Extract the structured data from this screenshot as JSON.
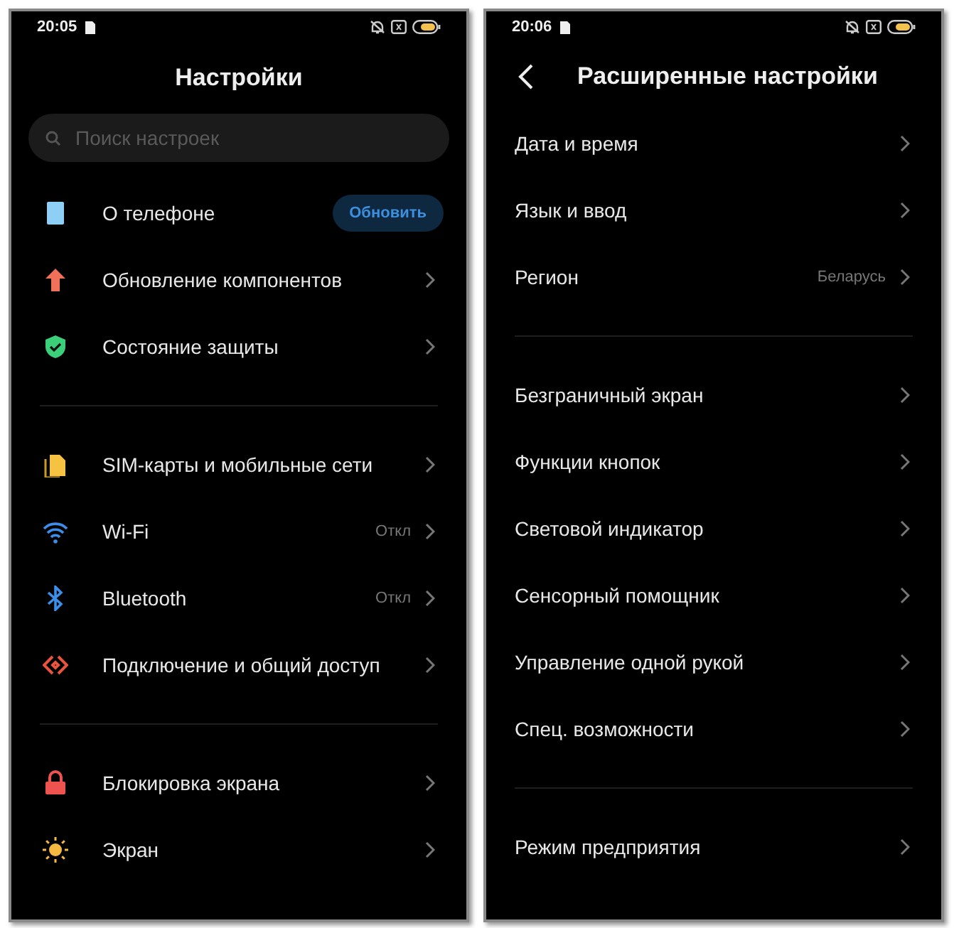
{
  "panels": [
    {
      "status_bar": {
        "time": "20:05"
      },
      "header": {
        "title": "Настройки",
        "back": false
      },
      "search": {
        "placeholder": "Поиск настроек"
      },
      "sections": [
        {
          "items": [
            {
              "kind": "phone",
              "label": "О телефоне",
              "button": "Обновить"
            },
            {
              "kind": "arrow-up",
              "label": "Обновление компонентов"
            },
            {
              "kind": "shield",
              "label": "Состояние защиты"
            }
          ]
        },
        {
          "items": [
            {
              "kind": "sim",
              "label": "SIM-карты и мобильные сети"
            },
            {
              "kind": "wifi",
              "label": "Wi-Fi",
              "value": "Откл"
            },
            {
              "kind": "bluetooth",
              "label": "Bluetooth",
              "value": "Откл"
            },
            {
              "kind": "share",
              "label": "Подключение и общий доступ"
            }
          ]
        },
        {
          "items": [
            {
              "kind": "lock",
              "label": "Блокировка экрана"
            },
            {
              "kind": "sun",
              "label": "Экран"
            }
          ]
        }
      ]
    },
    {
      "status_bar": {
        "time": "20:06"
      },
      "header": {
        "title": "Расширенные настройки",
        "back": true
      },
      "sections": [
        {
          "items": [
            {
              "kind": "plain",
              "label": "Дата и время"
            },
            {
              "kind": "plain",
              "label": "Язык и ввод"
            },
            {
              "kind": "plain",
              "label": "Регион",
              "value": "Беларусь"
            }
          ]
        },
        {
          "items": [
            {
              "kind": "plain",
              "label": "Безграничный экран"
            },
            {
              "kind": "plain",
              "label": "Функции кнопок"
            },
            {
              "kind": "plain",
              "label": "Световой индикатор"
            },
            {
              "kind": "plain",
              "label": "Сенсорный помощник"
            },
            {
              "kind": "plain",
              "label": "Управление одной рукой"
            },
            {
              "kind": "plain",
              "label": "Спец. возможности"
            }
          ]
        },
        {
          "items": [
            {
              "kind": "plain",
              "label": "Режим предприятия"
            }
          ]
        }
      ]
    }
  ]
}
